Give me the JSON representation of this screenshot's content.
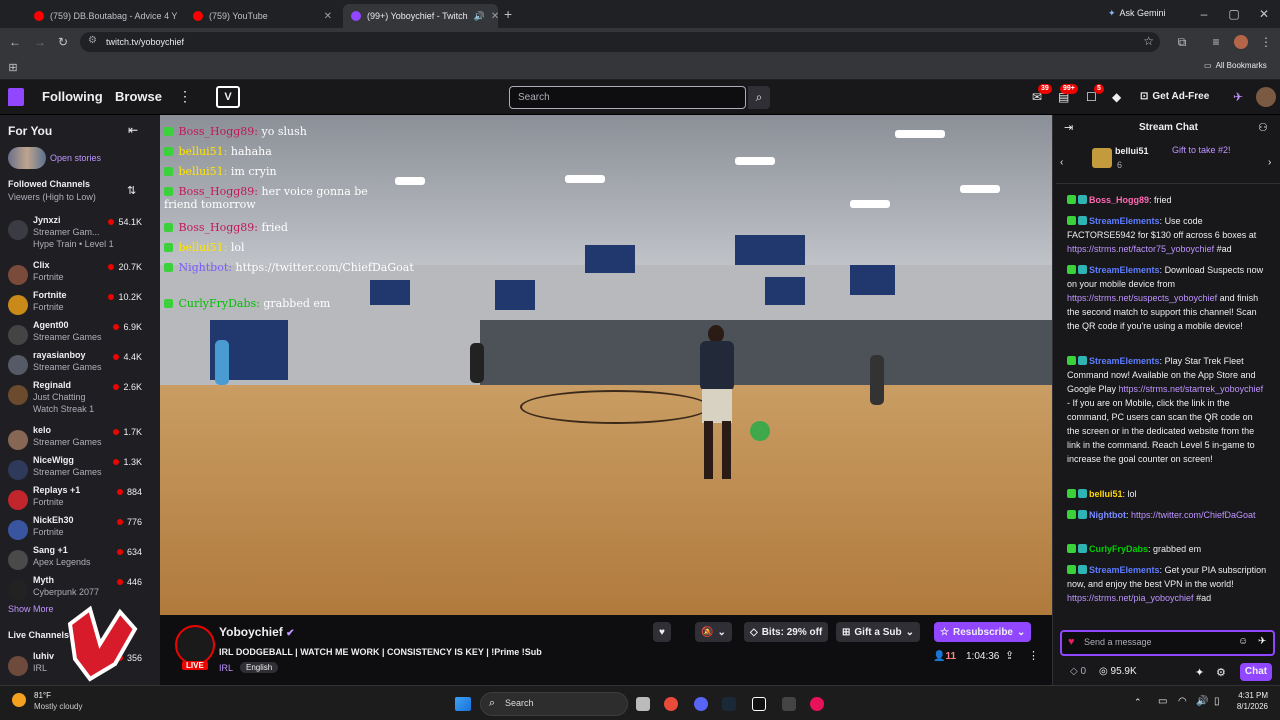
{
  "browser": {
    "tabs": [
      {
        "title": "(759) DB.Boutabag - Advice 4 Y",
        "favicon": "youtube-icon",
        "active": false
      },
      {
        "title": "(759) YouTube",
        "favicon": "youtube-icon",
        "active": false
      },
      {
        "title": "(99+) Yoboychief - Twitch",
        "favicon": "twitch-icon",
        "active": true
      }
    ],
    "ask_gemini": "Ask Gemini",
    "url": "twitch.tv/yoboychief",
    "all_bookmarks": "All Bookmarks"
  },
  "nav": {
    "following": "Following",
    "browse": "Browse",
    "search_placeholder": "Search",
    "badges": [
      "39",
      "99+",
      "5"
    ],
    "get_ad_free": "Get Ad-Free"
  },
  "sidebar": {
    "for_you": "For You",
    "open_stories": "Open stories",
    "followed_title": "Followed Channels",
    "followed_sort": "Viewers (High to Low)",
    "channels": [
      {
        "name": "Jynxzi",
        "game": "Streamer Gam...",
        "viewers": "54.1K",
        "extra": "Hype Train • Level 1",
        "color": "#3b3b44"
      },
      {
        "name": "Clix",
        "game": "Fortnite",
        "viewers": "20.7K",
        "color": "#7a4a3a"
      },
      {
        "name": "Fortnite",
        "game": "Fortnite",
        "viewers": "10.2K",
        "color": "#c98a1a"
      },
      {
        "name": "Agent00",
        "game": "Streamer Games",
        "viewers": "6.9K",
        "color": "#444"
      },
      {
        "name": "rayasianboy",
        "game": "Streamer Games",
        "viewers": "4.4K",
        "color": "#555a66"
      },
      {
        "name": "Reginald",
        "game": "Just Chatting",
        "viewers": "2.6K",
        "extra": "Watch Streak 1",
        "color": "#6b4a2e"
      },
      {
        "name": "kelo",
        "game": "Streamer Games",
        "viewers": "1.7K",
        "color": "#886655"
      },
      {
        "name": "NiceWigg",
        "game": "Streamer Games",
        "viewers": "1.3K",
        "color": "#2f3a5a"
      },
      {
        "name": "Replays +1",
        "game": "Fortnite",
        "viewers": "884",
        "color": "#c0262b"
      },
      {
        "name": "NickEh30",
        "game": "Fortnite",
        "viewers": "776",
        "color": "#3a55a0"
      },
      {
        "name": "Sang +1",
        "game": "Apex Legends",
        "viewers": "634",
        "color": "#4a4a4a"
      },
      {
        "name": "Myth",
        "game": "Cyberpunk 2077",
        "viewers": "446",
        "color": "#222"
      }
    ],
    "show_more": "Show More",
    "live_channels": "Live Channels",
    "live_items": [
      {
        "name": "luhiv",
        "game": "IRL",
        "viewers": "356"
      }
    ]
  },
  "overlay_chat": [
    {
      "user": "Boss_Hogg89",
      "text": "yo slush",
      "color": "#c2185b"
    },
    {
      "user": "bellui51",
      "text": "hahaha",
      "color": "#ffe400"
    },
    {
      "user": "bellui51",
      "text": "im cryin",
      "color": "#ffe400"
    },
    {
      "user": "Boss_Hogg89",
      "text": "her voice gonna be friend tomorrow",
      "color": "#c2185b"
    },
    {
      "user": "Boss_Hogg89",
      "text": "fried",
      "color": "#c2185b"
    },
    {
      "user": "bellui51",
      "text": "lol",
      "color": "#ffe400"
    },
    {
      "user": "Nightbot",
      "text": "https://twitter.com/ChiefDaGoat",
      "color": "#7b5cff"
    },
    {
      "user": "CurlyFryDabs",
      "text": "grabbed em",
      "color": "#00c000"
    }
  ],
  "stream": {
    "channel": "Yoboychief",
    "title": "IRL DODGEBALL | WATCH ME WORK | CONSISTENCY IS KEY | !Prime !Sub",
    "live": "LIVE",
    "tags": [
      "IRL",
      "English"
    ],
    "bits": "Bits: 29% off",
    "gift": "Gift a Sub",
    "resub": "Resubscribe",
    "viewers": "11",
    "uptime": "1:04:36"
  },
  "chat": {
    "title": "Stream Chat",
    "pinned_user": "bellui51",
    "pinned_count": "6",
    "gift_text": "Gift to take #2!",
    "messages": [
      {
        "user": "Boss_Hogg89",
        "color": "#ff69b4",
        "text": "fried",
        "link": ""
      },
      {
        "user": "StreamElements",
        "color": "#5c7cff",
        "text": "Use code FACTORSE5942 for $130 off across 6 boxes at",
        "link": "https://strms.net/factor75_yoboychief",
        "after": "#ad"
      },
      {
        "user": "StreamElements",
        "color": "#5c7cff",
        "text": "Download Suspects now on your mobile device from",
        "link": "https://strms.net/suspects_yoboychief",
        "after": "and finish the second match to support this channel! Scan the QR code if you're using a mobile device!"
      },
      {
        "user": "StreamElements",
        "color": "#5c7cff",
        "text": "Play Star Trek Fleet Command now! Available on the App Store and Google Play",
        "link": "https://strms.net/startrek_yoboychief",
        "after": "- If you are on Mobile, click the link in the command, PC users can scan the QR code on the screen or in the dedicated website from the link in the command. Reach Level 5 in-game to increase the goal counter on screen!"
      },
      {
        "user": "bellui51",
        "color": "#ffd700",
        "text": "lol",
        "link": ""
      },
      {
        "user": "Nightbot",
        "color": "#7b8cff",
        "text": "",
        "link": "https://twitter.com/ChiefDaGoat"
      },
      {
        "user": "CurlyFryDabs",
        "color": "#00d000",
        "text": "grabbed em",
        "link": ""
      },
      {
        "user": "StreamElements",
        "color": "#5c7cff",
        "text": "Get your PIA subscription now, and enjoy the best VPN in the world!",
        "link": "https://strms.net/pia_yoboychief",
        "after": "#ad"
      }
    ],
    "input_placeholder": "Send a message",
    "points": "0",
    "channel_points": "95.9K",
    "chat_button": "Chat"
  },
  "taskbar": {
    "weather_temp": "81°F",
    "weather_desc": "Mostly cloudy",
    "search": "Search",
    "time": "4:31 PM",
    "date": "8/1/2026"
  }
}
